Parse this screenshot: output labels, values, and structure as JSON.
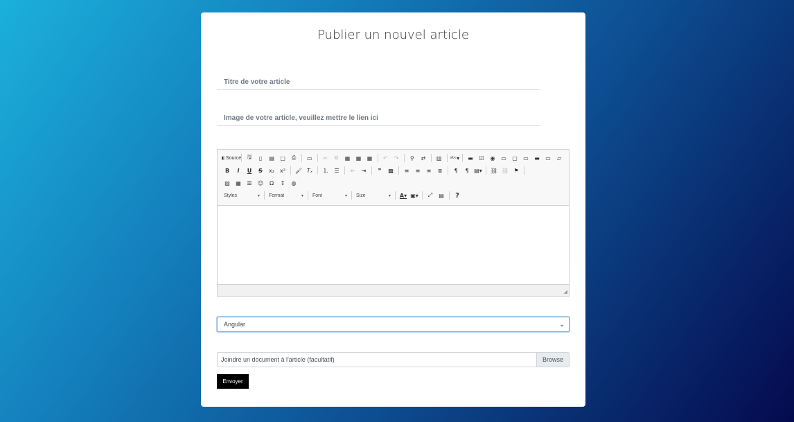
{
  "form": {
    "title": "Publier un nouvel article",
    "title_placeholder": "Titre de votre article",
    "image_placeholder": "Image de votre article, veuillez mettre le lien ici",
    "category_selected": "Angular",
    "file_placeholder": "Joindre un document à l'article (facultatif)",
    "browse_label": "Browse",
    "submit_label": "Envoyer"
  },
  "editor": {
    "source_label": "Source",
    "styles_label": "Styles",
    "format_label": "Format",
    "font_label": "Font",
    "size_label": "Size",
    "row1_icons": [
      "save-icon",
      "new-page-icon",
      "templates-icon",
      "preview-icon",
      "print-icon",
      "document-icon",
      "cut-icon",
      "copy-icon",
      "paste-icon",
      "paste-text-icon",
      "paste-word-icon",
      "undo-icon",
      "redo-icon",
      "find-icon",
      "replace-icon",
      "select-all-icon",
      "spellcheck-icon",
      "form-icon",
      "checkbox-icon",
      "radio-icon",
      "textfield-icon",
      "textarea-icon",
      "select-icon",
      "button-icon",
      "imagebutton-icon",
      "hiddenfield-icon"
    ],
    "row2_icons": [
      "bold-icon",
      "italic-icon",
      "underline-icon",
      "strike-icon",
      "subscript-icon",
      "superscript-icon",
      "copyformat-icon",
      "removeformat-icon",
      "numbered-list-icon",
      "bulleted-list-icon",
      "outdent-icon",
      "indent-icon",
      "blockquote-icon",
      "creatediv-icon",
      "align-left-icon",
      "align-center-icon",
      "align-right-icon",
      "justify-icon",
      "ltr-icon",
      "rtl-icon",
      "language-icon",
      "link-icon",
      "unlink-icon",
      "anchor-icon"
    ],
    "row3_icons": [
      "image-icon",
      "table-icon",
      "hr-icon",
      "smiley-icon",
      "specialchar-icon",
      "pagebreak-icon",
      "iframe-icon"
    ],
    "row4_icons": [
      "text-color-icon",
      "bg-color-icon",
      "maximize-icon",
      "showblocks-icon",
      "help-icon"
    ]
  }
}
